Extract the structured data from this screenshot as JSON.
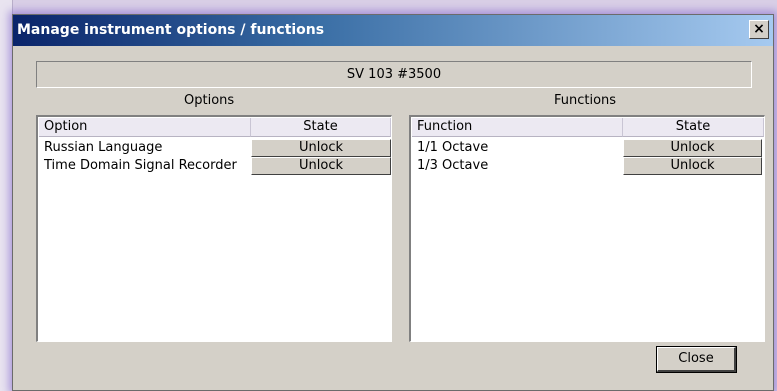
{
  "window": {
    "title": "Manage instrument options / functions",
    "close_glyph": "×",
    "instrument": "SV 103 #3500"
  },
  "options": {
    "section_label": "Options",
    "columns": [
      "Option",
      "State"
    ],
    "rows": [
      {
        "name": "Russian Language",
        "state": "Unlock"
      },
      {
        "name": "Time Domain Signal Recorder",
        "state": "Unlock"
      }
    ]
  },
  "functions": {
    "section_label": "Functions",
    "columns": [
      "Function",
      "State"
    ],
    "rows": [
      {
        "name": "1/1 Octave",
        "state": "Unlock"
      },
      {
        "name": "1/3 Octave",
        "state": "Unlock"
      }
    ]
  },
  "footer": {
    "close_label": "Close"
  },
  "colors": {
    "title_gradient_start": "#0a246a",
    "title_gradient_end": "#a6caf0",
    "dialog_bg": "#d4d0c8",
    "glow": "#7a5ac8"
  }
}
